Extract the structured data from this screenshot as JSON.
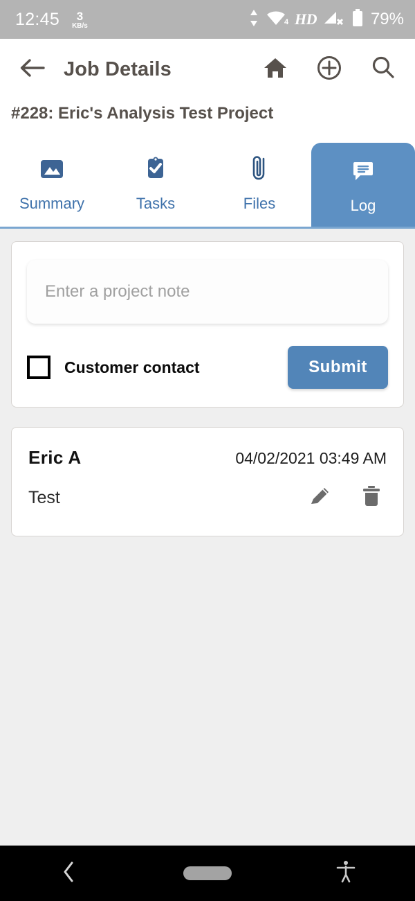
{
  "status_bar": {
    "clock": "12:45",
    "net_speed_value": "3",
    "net_speed_unit": "KB/s",
    "wifi_level": "4",
    "voice_badge": "HD",
    "battery": "79%",
    "background_color": "#b4b4b4"
  },
  "app_bar": {
    "back_icon": "back-arrow-icon",
    "title": "Job Details",
    "actions": [
      {
        "name": "home-icon"
      },
      {
        "name": "add-circle-icon"
      },
      {
        "name": "search-icon"
      }
    ]
  },
  "project": {
    "subtitle": "#228: Eric's Analysis Test Project"
  },
  "tabs": {
    "active_color": "#5d90c3",
    "inactive_label_color": "#3f72ab",
    "items": [
      {
        "label": "Summary",
        "icon": "image-icon",
        "active": false
      },
      {
        "label": "Tasks",
        "icon": "clipboard-check-icon",
        "active": false
      },
      {
        "label": "Files",
        "icon": "paperclip-icon",
        "active": false
      },
      {
        "label": "Log",
        "icon": "comment-icon",
        "active": true
      }
    ]
  },
  "compose": {
    "note_placeholder": "Enter a project note",
    "note_value": "",
    "checkbox_label": "Customer contact",
    "checkbox_checked": false,
    "submit_label": "Submit",
    "submit_color": "#5285b8"
  },
  "log_entries": [
    {
      "author": "Eric A",
      "timestamp": "04/02/2021 03:49 AM",
      "text": "Test",
      "edit_icon": "pencil-icon",
      "delete_icon": "trash-icon"
    }
  ],
  "nav_bar": {
    "back": "nav-back-icon",
    "home": "nav-home-pill",
    "accessibility": "accessibility-icon"
  }
}
